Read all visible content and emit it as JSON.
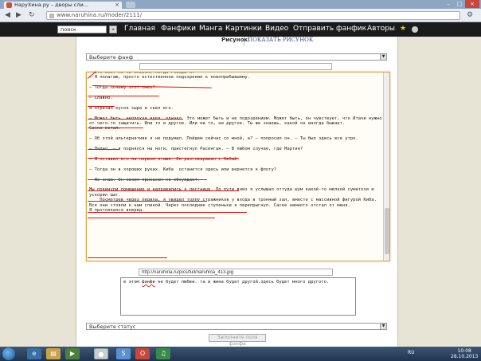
{
  "browser": {
    "tab_title": "НаруХина.ру – дворы сли...",
    "url": "www.naruhina.ru/moder/2111/"
  },
  "site_nav": {
    "search_placeholder": "поиск",
    "links": [
      "Главная",
      "Фанфики",
      "Манга",
      "Картинки",
      "Видео",
      "Отправить фанфик",
      "Авторы"
    ]
  },
  "form": {
    "picture_label": "Рисунок:",
    "picture_link": "ПОКАЗАТЬ РИСУНОК",
    "fanfic_select": "Выберите фанф",
    "text_paragraphs": [
      "— Это все. Но не смейся, когда говорю я.",
      "— Я полагаю, просто естественное подозрение к новоприбывшему.",
      "",
      "— Тогда почему этот смех?",
      "",
      "— Славно.",
      "",
      "Я отрезал кусок сыра и съел его.",
      "",
      "— Может быть, неплохая идея, однако. Это может быть и не подозрением. Может быть, он чувствует, что Итачи нужно от чего-то защитить. Или то и другое. Или ни то, ни другое. Ты же знаешь, какой он иногда бывает.",
      "Саске встал.",
      "",
      "— Об этой альтернативе я не подумал. Пойдем сейчас со мной, а? — попросил он. — Ты был здесь все утро.",
      "",
      "— Ладно, — я поднялся на ноги, пристегнул Расенган. — В любом случае, где Мартин?",
      "",
      "— Я оставил его на первом этаже. Он разговаривал с Хибай.",
      "",
      "— Тогда он в хороших руках. Киба  останется здесь или вернется к флоту?",
      "",
      "— Не знаю. Он своим приказом не обсуждает.",
      "",
      "Мы покинули помещение и направились к лестнице. По пути вниз я услышал оттуда шум какой-то мелкой суматохи и ускорил шаг.",
      "    Посмотрев через перила, я увидел толпу стражников у входа в тронный зал, вместе с массивной фигурой Киба. Все они стояли к нам спиной. Через последние ступеньки я перепрыгнул. Саске немного отстал от меня.",
      "Я протолкался вперед."
    ],
    "image_url": "http://naruhina.ru/pics/full/naruhina_413.jpg",
    "comment_prefix": "в этом ",
    "comment_misspelled": "фанфи",
    "comment_suffix": " не будет любви. та и жина будет другой.здесь будет много другого.",
    "status_select": "Выберите статус",
    "submit_label": "Заполните поля фанфа"
  },
  "taskbar": {
    "lang": "RU",
    "time": "10:08",
    "date": "28.10.2013"
  }
}
